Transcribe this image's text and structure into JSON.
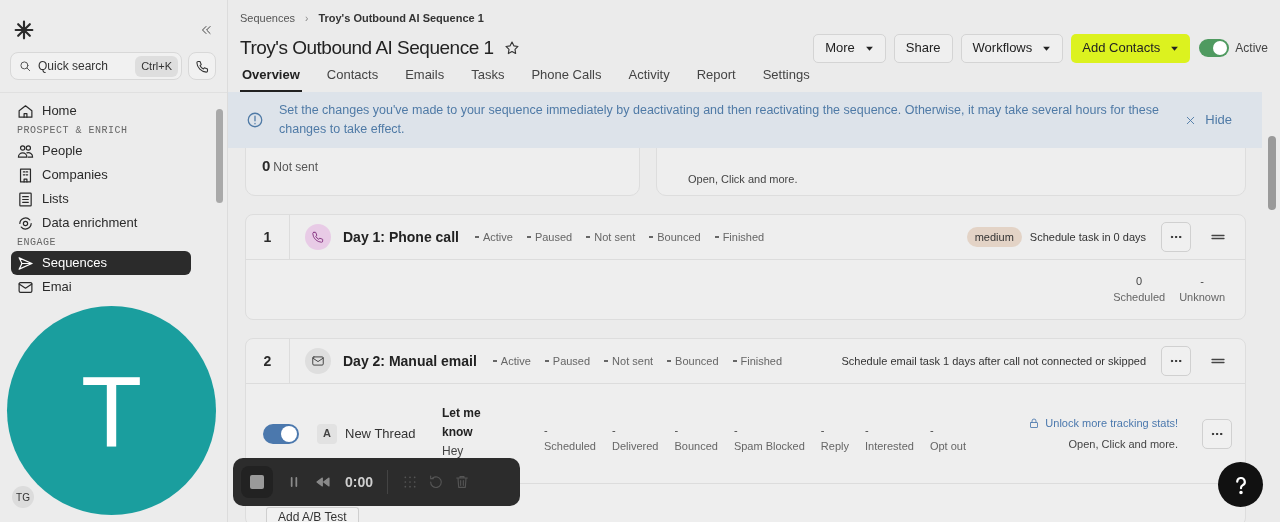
{
  "sidebar": {
    "search": {
      "placeholder": "Quick search",
      "shortcut": "Ctrl+K"
    },
    "nav": [
      {
        "kind": "item",
        "label": "Home",
        "selected": false
      },
      {
        "kind": "section",
        "label": "PROSPECT & ENRICH"
      },
      {
        "kind": "item",
        "label": "People",
        "selected": false
      },
      {
        "kind": "item",
        "label": "Companies",
        "selected": false
      },
      {
        "kind": "item",
        "label": "Lists",
        "selected": false
      },
      {
        "kind": "item",
        "label": "Data enrichment",
        "selected": false
      },
      {
        "kind": "section",
        "label": "ENGAGE"
      },
      {
        "kind": "item",
        "label": "Sequences",
        "selected": true
      },
      {
        "kind": "item",
        "label": "Emai",
        "selected": false
      }
    ],
    "user_initials": "TG"
  },
  "camera_avatar": {
    "letter": "T"
  },
  "recorder": {
    "time": "0:00"
  },
  "header": {
    "breadcrumb_separator": "›",
    "breadcrumb": [
      "Sequences",
      "Troy's Outbound AI Sequence 1"
    ],
    "title": "Troy's Outbound AI Sequence 1",
    "buttons": [
      {
        "label": "More",
        "dropdown": true,
        "kind": "outline"
      },
      {
        "label": "Share",
        "dropdown": false,
        "kind": "outline"
      },
      {
        "label": "Workflows",
        "dropdown": true,
        "kind": "outline"
      },
      {
        "label": "Add Contacts",
        "dropdown": true,
        "kind": "primary"
      }
    ],
    "status_toggle": {
      "on": true,
      "label": "Active"
    },
    "tabs": [
      {
        "label": "Overview",
        "selected": true
      },
      {
        "label": "Contacts",
        "selected": false
      },
      {
        "label": "Emails",
        "selected": false
      },
      {
        "label": "Tasks",
        "selected": false
      },
      {
        "label": "Phone Calls",
        "selected": false
      },
      {
        "label": "Activity",
        "selected": false
      },
      {
        "label": "Report",
        "selected": false
      },
      {
        "label": "Settings",
        "selected": false
      }
    ]
  },
  "banner": {
    "text": "Set the changes you've made to your sequence immediately by deactivating and then reactivating the sequence. Otherwise, it may take several hours for these changes to take effect.",
    "action": "Hide"
  },
  "summary": {
    "count": "0",
    "count_label": "Not sent",
    "tracking_note": "Open, Click and more."
  },
  "steps": [
    {
      "number": "1",
      "kind": "call",
      "title": "Day 1: Phone call",
      "statuses": [
        "Active",
        "Paused",
        "Not sent",
        "Bounced",
        "Finished"
      ],
      "priority": "medium",
      "schedule": "Schedule task in 0 days",
      "stats": [
        {
          "value": "0",
          "label": "Scheduled"
        },
        {
          "value": "-",
          "label": "Unknown"
        }
      ]
    },
    {
      "number": "2",
      "kind": "email",
      "title": "Day 2: Manual email",
      "statuses": [
        "Active",
        "Paused",
        "Not sent",
        "Bounced",
        "Finished"
      ],
      "schedule": "Schedule email task 1 days after call not connected or skipped",
      "variant": {
        "on": true,
        "letter": "A",
        "name": "New Thread",
        "subject": "Let me know",
        "preview": "Hey",
        "stats": [
          {
            "value": "-",
            "label": "Scheduled"
          },
          {
            "value": "-",
            "label": "Delivered"
          },
          {
            "value": "-",
            "label": "Bounced"
          },
          {
            "value": "-",
            "label": "Spam Blocked"
          },
          {
            "value": "-",
            "label": "Reply"
          },
          {
            "value": "-",
            "label": "Interested"
          },
          {
            "value": "-",
            "label": "Opt out"
          }
        ],
        "unlock": "Unlock more tracking stats!",
        "unlock_note": "Open, Click and more."
      },
      "add_ab": "Add A/B Test"
    }
  ]
}
